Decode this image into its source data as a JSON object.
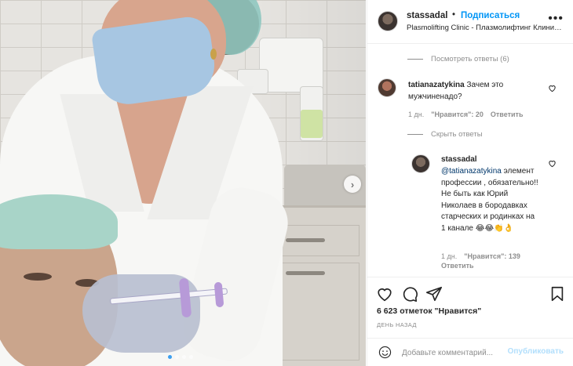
{
  "post": {
    "username": "stassadal",
    "dot": "•",
    "follow_label": "Подписаться",
    "location": "Plasmolifting Clinic - Плазмолифтинг Клиник...",
    "more": "•••"
  },
  "comments": {
    "view_replies": "Посмотреть ответы (6)",
    "hide_replies": "Скрыть ответы",
    "items": [
      {
        "username": "tatianazatykina",
        "text": "Зачем это мужчиненадо?",
        "time": "1 дн.",
        "likes": "\"Нравится\": 20",
        "reply": "Ответить"
      },
      {
        "username": "stassadal",
        "mention": "@tatianazatykina",
        "text": "элемент профессии , обязательно!!Не быть как Юрий Николаев в бородавках старческих и родинках на 1 канале",
        "emojis": "😂😂👏👌",
        "time": "1 дн.",
        "likes": "\"Нравится\": 139",
        "reply": "Ответить"
      }
    ]
  },
  "actions": {
    "likes": "6 623 отметок \"Нравится\"",
    "posted_ago": "ДЕНЬ НАЗАД"
  },
  "add_comment": {
    "placeholder": "Добавьте комментарий...",
    "publish_label": "Опубликовать"
  },
  "carousel": {
    "next_arrow": "›",
    "slide_count": 4,
    "active_index": 0
  },
  "colors": {
    "accent": "#0095f6",
    "publish_disabled": "#b2dffc",
    "secondary_text": "#8e8e8e",
    "active_dot": "#3c9ff0"
  },
  "icons": [
    "heart-icon",
    "comment-icon",
    "share-icon",
    "bookmark-icon",
    "emoji-icon",
    "more-icon",
    "chevron-right-icon"
  ]
}
